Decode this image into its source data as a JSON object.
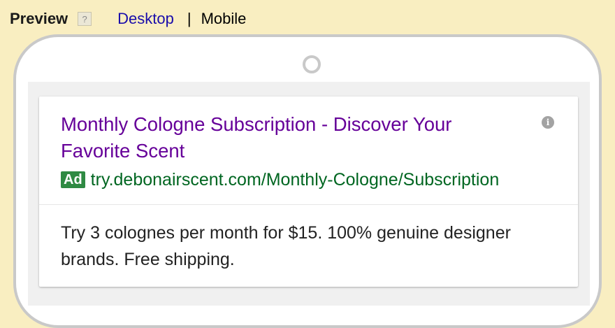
{
  "header": {
    "title": "Preview",
    "help_icon": "?",
    "tabs": [
      {
        "label": "Desktop",
        "active": false
      },
      {
        "label": "Mobile",
        "active": true
      }
    ],
    "separator": "|"
  },
  "ad": {
    "headline": "Monthly Cologne Subscription - Discover Your Favorite Scent",
    "badge": "Ad",
    "display_url": "try.debonairscent.com/Monthly-Cologne/Subscription",
    "description": "Try 3 colognes per month for $15. 100% genuine designer brands. Free shipping.",
    "info_icon": "i"
  },
  "colors": {
    "page_background": "#f9eec1",
    "link_blue": "#1a0dab",
    "headline_purple": "#660099",
    "url_green": "#006621",
    "badge_green": "#2f8a43",
    "phone_frame": "#c9c9c9"
  }
}
